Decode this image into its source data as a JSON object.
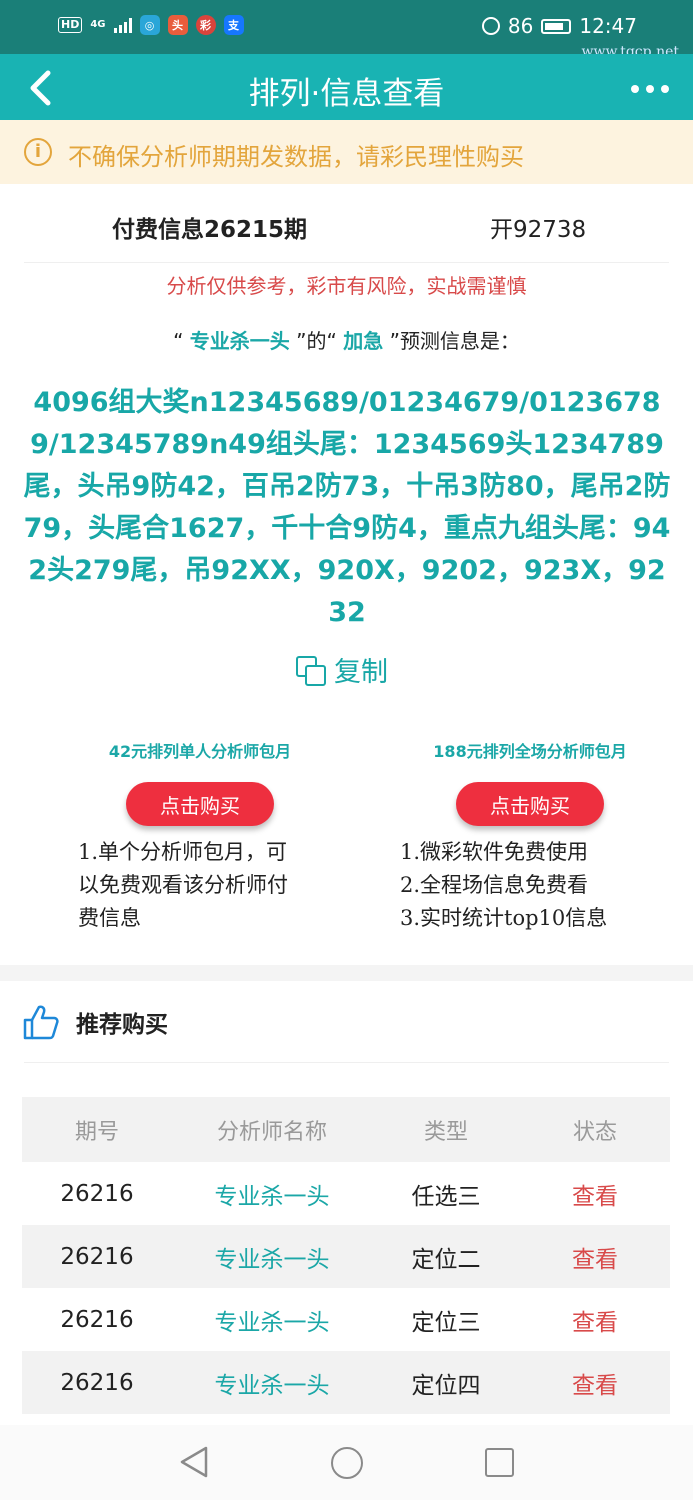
{
  "status_bar": {
    "hd": "HD",
    "network": "4G",
    "battery_pct": "86",
    "time": "12:47",
    "watermark": "www.tqcp.net",
    "app_icons": [
      {
        "icon": "weather-app-icon",
        "color": "#2aa6d8",
        "glyph": "◎"
      },
      {
        "icon": "news-app-icon",
        "color": "#e85d3c",
        "glyph": "头"
      },
      {
        "icon": "lottery-app-icon",
        "color": "#d9443c",
        "glyph": "彩"
      },
      {
        "icon": "alipay-icon",
        "color": "#1677ff",
        "glyph": "支"
      }
    ]
  },
  "header": {
    "title": "排列·信息查看"
  },
  "warning": {
    "text": "不确保分析师期期发数据，请彩民理性购买"
  },
  "info": {
    "title": "付费信息26215期",
    "open_result": "开92738",
    "risk_note": "分析仅供参考，彩市有风险，实战需谨慎",
    "predict_prefix": "“ ",
    "analyst": "专业杀一头",
    "predict_mid": " ”的“ ",
    "urgency": "加急",
    "predict_suffix": " ”预测信息是：",
    "prediction": "4096组大奖n12345689/01234679/01236789/12345789n49组头尾：1234569头1234789尾，头吊9防42，百吊2防73，十吊3防80，尾吊2防79，头尾合1627，千十合9防4，重点九组头尾：942头279尾，吊92XX，920X，9202，923X，9232",
    "copy_label": "复制"
  },
  "packages": [
    {
      "title": "42元排列单人分析师包月",
      "button": "点击购买",
      "items": [
        "1.单个分析师包月，可以免费观看该分析师付费信息"
      ]
    },
    {
      "title": "188元排列全场分析师包月",
      "button": "点击购买",
      "items": [
        "1.微彩软件免费使用",
        "2.全程场信息免费看",
        "3.实时统计top10信息"
      ]
    }
  ],
  "recommend": {
    "title": "推荐购买",
    "columns": [
      "期号",
      "分析师名称",
      "类型",
      "状态"
    ],
    "rows": [
      {
        "issue": "26216",
        "analyst": "专业杀一头",
        "type": "任选三",
        "status": "查看"
      },
      {
        "issue": "26216",
        "analyst": "专业杀一头",
        "type": "定位二",
        "status": "查看"
      },
      {
        "issue": "26216",
        "analyst": "专业杀一头",
        "type": "定位三",
        "status": "查看"
      },
      {
        "issue": "26216",
        "analyst": "专业杀一头",
        "type": "定位四",
        "status": "查看"
      }
    ]
  },
  "colors": {
    "status_bar": "#1a7f78",
    "header": "#19b3b3",
    "accent_teal": "#18a7a7",
    "warning_bg": "#fdf3df",
    "warning_text": "#e3a53c",
    "buy_button": "#ee2f3f",
    "status_red": "#d84a4a"
  }
}
